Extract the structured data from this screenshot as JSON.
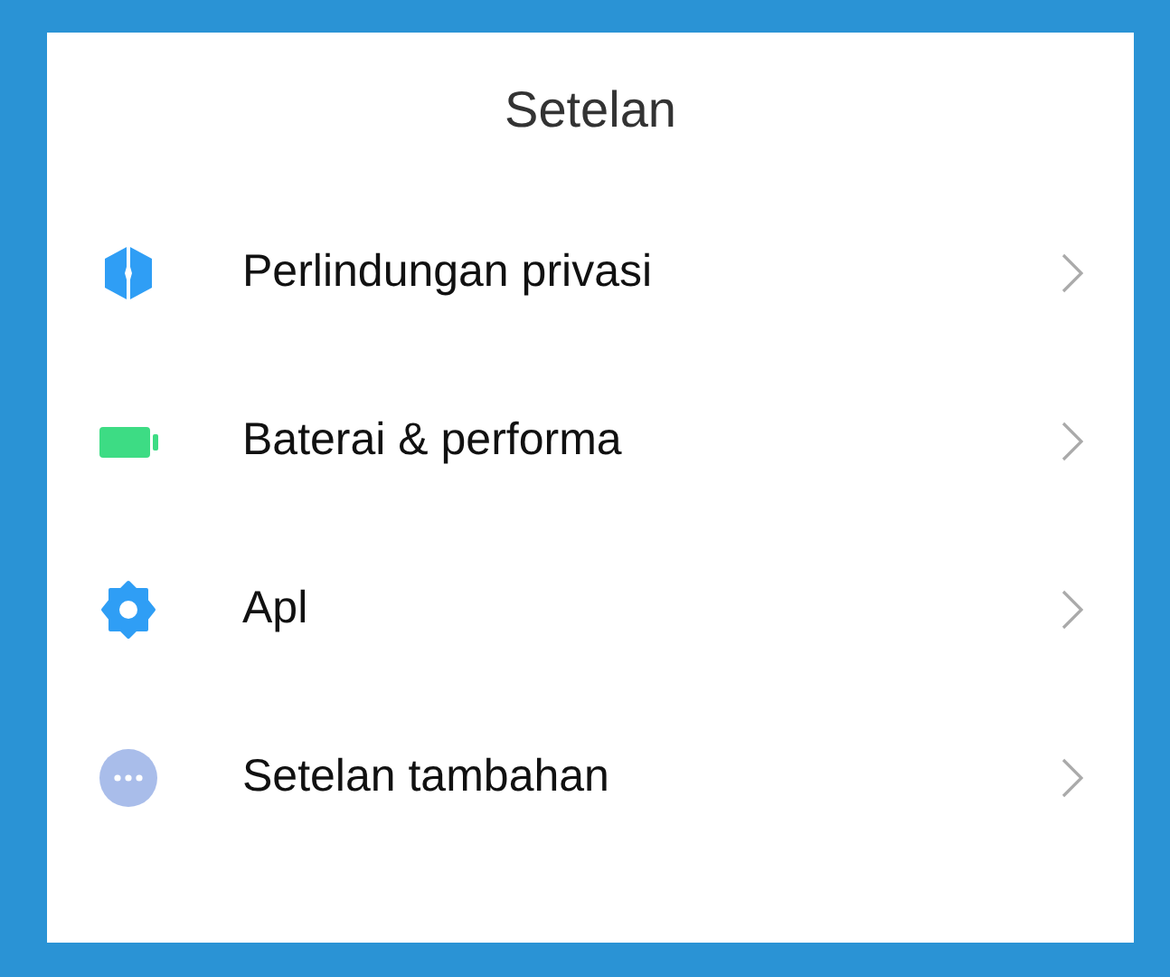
{
  "title": "Setelan",
  "items": [
    {
      "kind": "shield",
      "label": "Perlindungan privasi"
    },
    {
      "kind": "battery",
      "label": "Baterai & performa"
    },
    {
      "kind": "gear",
      "label": "Apl"
    },
    {
      "kind": "more",
      "label": "Setelan tambahan"
    }
  ]
}
